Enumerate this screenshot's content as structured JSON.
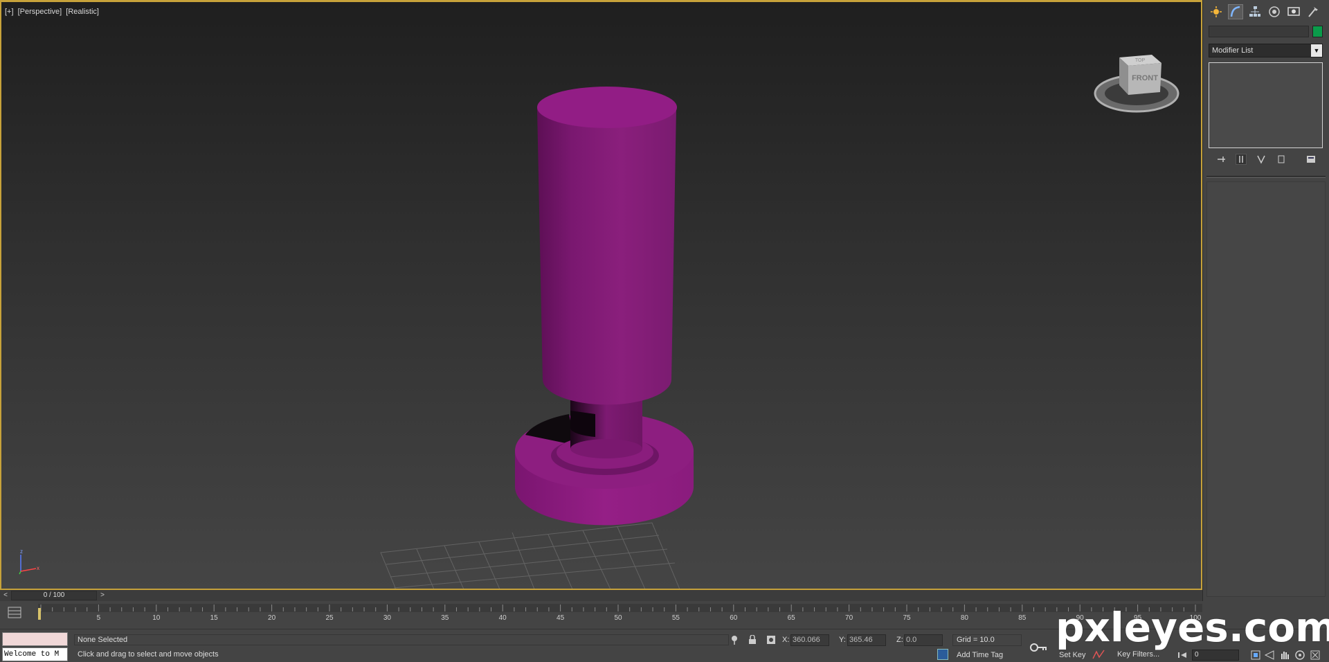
{
  "viewport": {
    "label_parts": [
      "[+]",
      "[Perspective]",
      "[Realistic]"
    ],
    "object_color": "#8a1f7c",
    "viewcube_label": "FRONT",
    "viewcube_top_label": "TOP"
  },
  "command_panel": {
    "tabs": [
      "create-icon",
      "modify-icon",
      "hierarchy-icon",
      "motion-icon",
      "display-icon",
      "utilities-icon"
    ],
    "name_value": "",
    "object_color": "#0a9b4a",
    "modifier_list_label": "Modifier List"
  },
  "time_slider": {
    "position_label": "0 / 100",
    "prev": "<",
    "next": ">"
  },
  "track_bar": {
    "ticks": [
      "5",
      "10",
      "15",
      "20",
      "25",
      "30",
      "35",
      "40",
      "45",
      "50",
      "55",
      "60",
      "65",
      "70",
      "75",
      "80",
      "85",
      "90",
      "95",
      "100"
    ]
  },
  "status_bar": {
    "listener_text": "Welcome to M",
    "selection_info": "None Selected",
    "prompt": "Click and drag to select and move objects",
    "x_label": "X:",
    "x_value": "360.066",
    "y_label": "Y:",
    "y_value": "365.46",
    "z_label": "Z:",
    "z_value": "0.0",
    "grid": "Grid = 10.0",
    "add_time_tag": "Add Time Tag",
    "set_key": "Set Key",
    "key_filters": "Key Filters...",
    "current_frame": "0"
  },
  "watermark": "pxleyes.com"
}
